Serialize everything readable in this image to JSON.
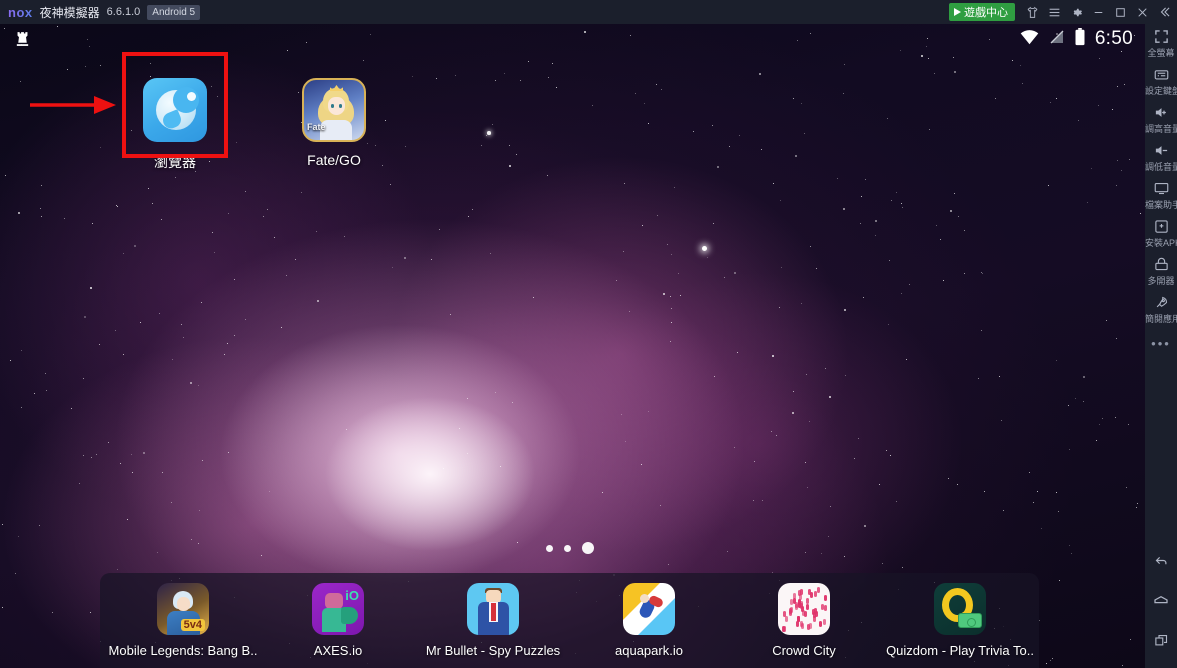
{
  "titlebar": {
    "logo": "nox",
    "app_name": "夜神模擬器",
    "version": "6.6.1.0",
    "android_badge": "Android 5",
    "game_center_label": "遊戲中心",
    "controls": [
      {
        "name": "skin-icon",
        "title": "換膚"
      },
      {
        "name": "menu-icon",
        "title": "選單"
      },
      {
        "name": "settings-icon",
        "title": "設定"
      },
      {
        "name": "minimize-icon",
        "title": "最小化"
      },
      {
        "name": "maximize-icon",
        "title": "最大化"
      },
      {
        "name": "close-icon",
        "title": "關閉"
      },
      {
        "name": "collapse-icon",
        "title": "收合"
      }
    ]
  },
  "statusbar": {
    "notification_icon": "chess-rook-icon",
    "wifi_icon": "wifi-icon",
    "signal_icon": "signal-off-icon",
    "battery_icon": "battery-icon",
    "time": "6:50"
  },
  "desktop": {
    "apps": [
      {
        "name": "browser",
        "label": "瀏覽器",
        "icon": "browser-icon",
        "highlighted": true
      },
      {
        "name": "fate-go",
        "label": "Fate/GO",
        "icon": "fate-go-icon",
        "highlighted": false
      }
    ],
    "fate_icon_text": "Fate",
    "page_dots": {
      "count": 3,
      "active_index": 2
    }
  },
  "annotation": {
    "box_color": "#ee1111",
    "arrow_color": "#ee1111",
    "target": "瀏覽器"
  },
  "dock": {
    "apps": [
      {
        "name": "mobile-legends",
        "label": "Mobile Legends: Bang B..",
        "badge": "5v4"
      },
      {
        "name": "axes-io",
        "label": "AXES.io",
        "badge": "iO"
      },
      {
        "name": "mr-bullet",
        "label": "Mr Bullet - Spy Puzzles",
        "badge": ""
      },
      {
        "name": "aquapark-io",
        "label": "aquapark.io",
        "badge": ""
      },
      {
        "name": "crowd-city",
        "label": "Crowd City",
        "badge": ""
      },
      {
        "name": "quizdom",
        "label": "Quizdom - Play Trivia To..",
        "badge": ""
      }
    ]
  },
  "sidebar": {
    "items": [
      {
        "name": "fullscreen",
        "label": "全螢幕",
        "icon": "fullscreen-icon"
      },
      {
        "name": "keyboard-settings",
        "label": "設定鍵盤",
        "icon": "keyboard-icon"
      },
      {
        "name": "volume-up",
        "label": "調高音量",
        "icon": "volume-up-icon"
      },
      {
        "name": "volume-down",
        "label": "調低音量",
        "icon": "volume-down-icon"
      },
      {
        "name": "file-assistant",
        "label": "檔案助手",
        "icon": "monitor-icon"
      },
      {
        "name": "install-apk",
        "label": "安裝APK",
        "icon": "apk-icon"
      },
      {
        "name": "multi-instance",
        "label": "多開器",
        "icon": "multi-icon"
      },
      {
        "name": "open-app",
        "label": "簡閱應用",
        "icon": "rocket-icon"
      }
    ],
    "more_label": "•••",
    "nav": [
      {
        "name": "back",
        "icon": "back-icon"
      },
      {
        "name": "home",
        "icon": "home-icon"
      },
      {
        "name": "recents",
        "icon": "recents-icon"
      }
    ]
  }
}
